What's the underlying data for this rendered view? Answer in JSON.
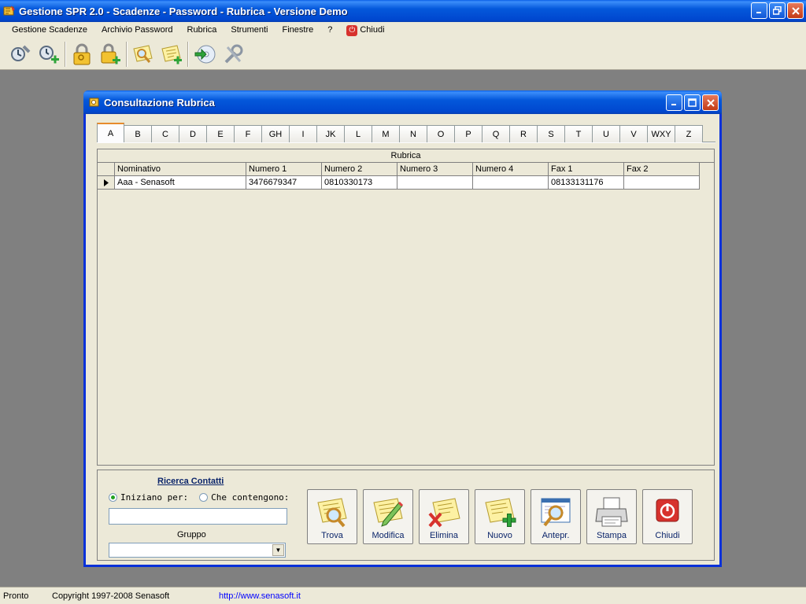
{
  "window": {
    "title": "Gestione SPR 2.0 - Scadenze - Password - Rubrica - Versione Demo"
  },
  "menu": {
    "items": [
      "Gestione Scadenze",
      "Archivio Password",
      "Rubrica",
      "Strumenti",
      "Finestre",
      "?"
    ],
    "close_label": "Chiudi"
  },
  "toolbar": {
    "icons": [
      "scadenze-icon",
      "nuova-scadenza-icon",
      "password-icon",
      "nuova-password-icon",
      "rubrica-cerca-icon",
      "rubrica-nuovo-icon",
      "esporta-icon",
      "strumenti-icon"
    ]
  },
  "child": {
    "title": "Consultazione Rubrica"
  },
  "tabs": {
    "letters": [
      "A",
      "B",
      "C",
      "D",
      "E",
      "F",
      "GH",
      "I",
      "JK",
      "L",
      "M",
      "N",
      "O",
      "P",
      "Q",
      "R",
      "S",
      "T",
      "U",
      "V",
      "WXY",
      "Z"
    ],
    "active": "A"
  },
  "grid": {
    "caption": "Rubrica",
    "columns": [
      "Nominativo",
      "Numero 1",
      "Numero 2",
      "Numero 3",
      "Numero 4",
      "Fax 1",
      "Fax 2"
    ],
    "rows": [
      [
        "Aaa - Senasoft",
        "3476679347",
        "0810330173",
        "",
        "",
        "08133131176",
        ""
      ]
    ]
  },
  "search": {
    "title": "Ricerca Contatti",
    "option_starts": "Iniziano per:",
    "option_contains": "Che contengono:",
    "selected": "starts",
    "value": "",
    "group_label": "Gruppo",
    "group_value": ""
  },
  "actions": {
    "trova": "Trova",
    "modifica": "Modifica",
    "elimina": "Elimina",
    "nuovo": "Nuovo",
    "antepr": "Antepr.",
    "stampa": "Stampa",
    "chiudi": "Chiudi"
  },
  "status": {
    "state": "Pronto",
    "copyright": "Copyright 1997-2008 Senasoft",
    "url": "http://www.senasoft.it"
  },
  "colors": {
    "title_bar": "#0458db",
    "face": "#ece9d8",
    "mdi_background": "#808080",
    "link": "#0000ff",
    "tab_active_accent": "#e68b2c"
  }
}
